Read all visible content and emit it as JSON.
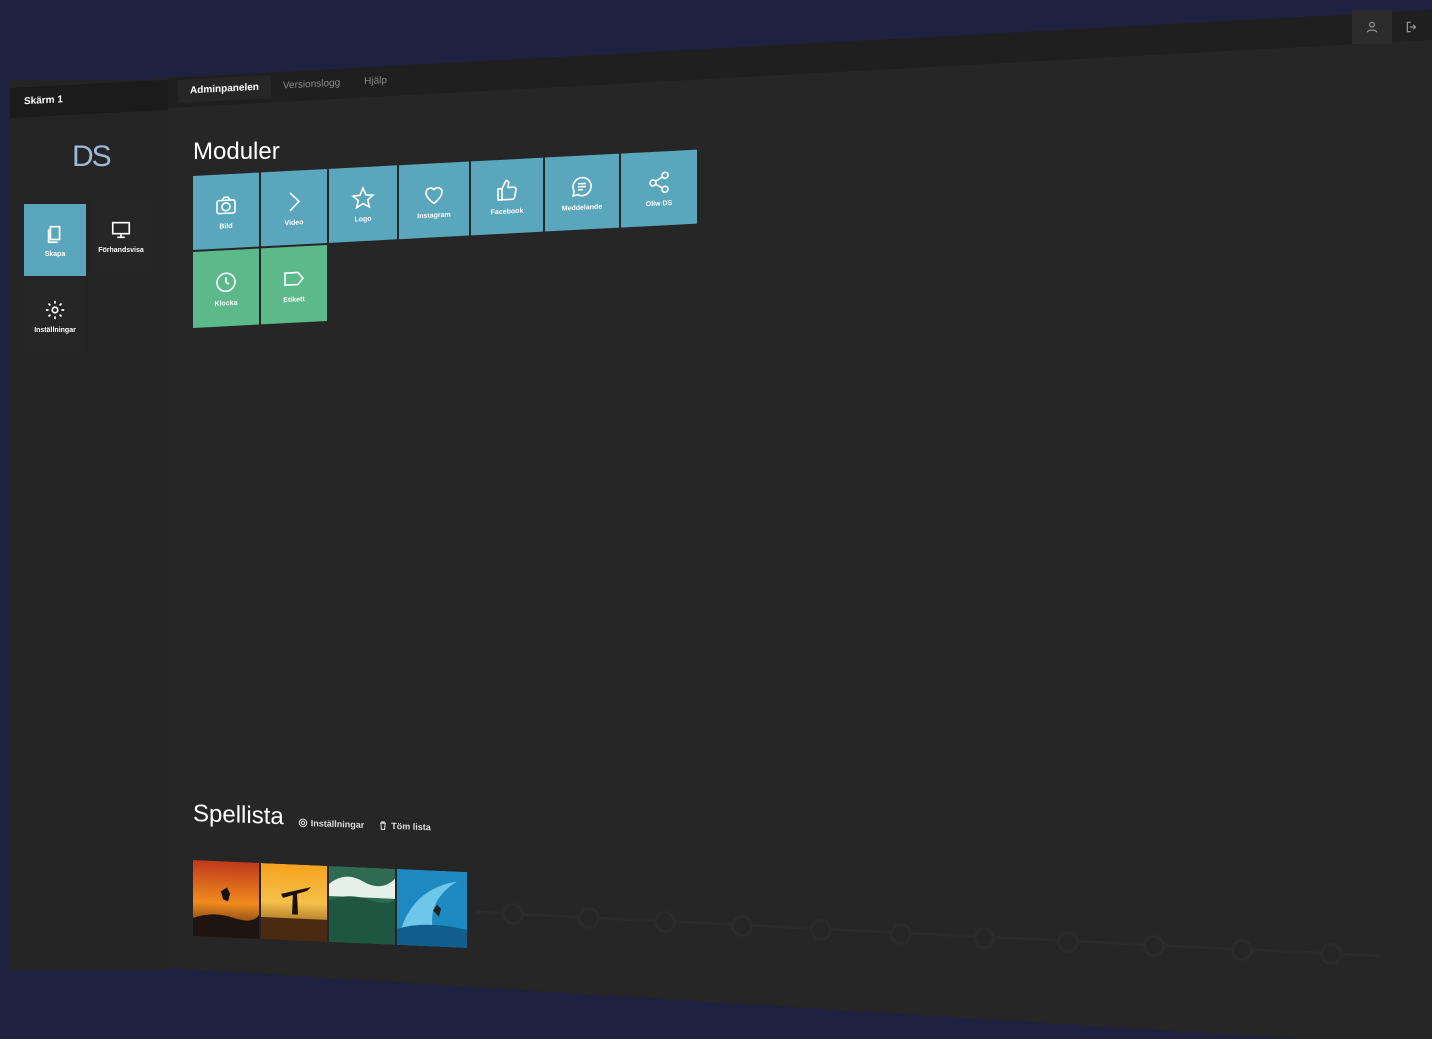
{
  "screen": {
    "label": "Skärm 1"
  },
  "tabs": [
    {
      "label": "Adminpanelen",
      "active": true
    },
    {
      "label": "Versionslogg",
      "active": false
    },
    {
      "label": "Hjälp",
      "active": false
    }
  ],
  "logo": {
    "text": "DS"
  },
  "nav": {
    "create_label": "Skapa",
    "preview_label": "Förhandsvisa",
    "settings_label": "Inställningar"
  },
  "modules": {
    "title": "Moduler",
    "items": [
      {
        "label": "Bild",
        "icon": "camera-icon"
      },
      {
        "label": "Video",
        "icon": "chevron-right-icon"
      },
      {
        "label": "Logo",
        "icon": "star-icon"
      },
      {
        "label": "Instagram",
        "icon": "heart-icon"
      },
      {
        "label": "Facebook",
        "icon": "thumbs-up-icon"
      },
      {
        "label": "Meddelande",
        "icon": "message-icon"
      },
      {
        "label": "Oliw DS",
        "icon": "share-icon"
      },
      {
        "label": "Klocka",
        "icon": "clock-icon"
      },
      {
        "label": "Etikett",
        "icon": "tag-icon"
      }
    ]
  },
  "playlist": {
    "title": "Spellista",
    "settings_label": "Inställningar",
    "clear_label": "Töm lista"
  },
  "colors": {
    "background": "#1e2140",
    "panel": "#262626",
    "sidebar": "#242424",
    "accent_blue": "#5aa6bd",
    "accent_green": "#5cb98a"
  }
}
